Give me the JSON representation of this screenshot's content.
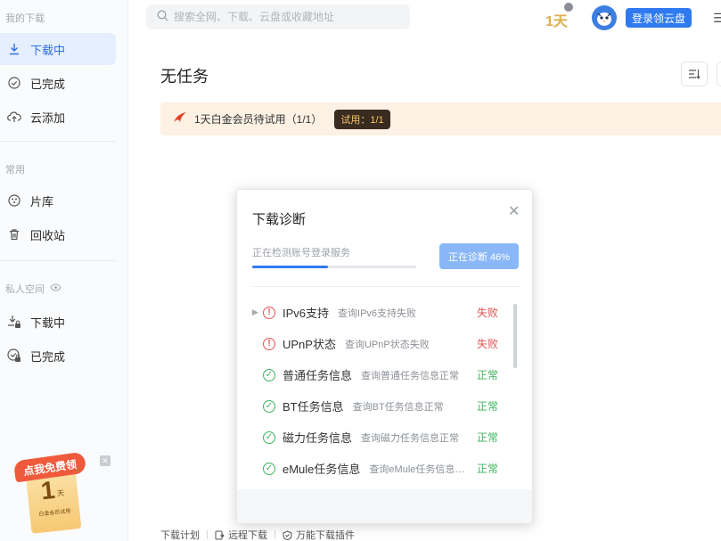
{
  "sidebar": {
    "section_downloads": "我的下载",
    "items_main": [
      {
        "label": "下载中",
        "icon": "download-icon",
        "active": true
      },
      {
        "label": "已完成",
        "icon": "check-circle-icon",
        "active": false
      },
      {
        "label": "云添加",
        "icon": "cloud-upload-icon",
        "active": false
      }
    ],
    "section_common": "常用",
    "items_common": [
      {
        "label": "片库",
        "icon": "film-icon"
      },
      {
        "label": "回收站",
        "icon": "trash-icon"
      }
    ],
    "section_private": "私人空间",
    "items_private": [
      {
        "label": "下载中",
        "icon": "locked-download-icon"
      },
      {
        "label": "已完成",
        "icon": "locked-check-icon"
      }
    ],
    "promo": {
      "badge": "点我免费领",
      "number": "1",
      "unit": "天",
      "caption": "白金会员试用"
    }
  },
  "topbar": {
    "search_placeholder": "搜索全网、下载、云盘或收藏地址",
    "vip_label": "1天",
    "login_button": "登录领云盘"
  },
  "main": {
    "title": "无任务",
    "trial_text": "1天白金会员待试用（1/1）",
    "trial_pill": "试用：1/1"
  },
  "footer": {
    "links": [
      "下载计划",
      "远程下载",
      "万能下载插件"
    ]
  },
  "dialog": {
    "title": "下载诊断",
    "status": "正在检测账号登录服务",
    "progress": 0.46,
    "button": "正在诊断 46%",
    "rows": [
      {
        "name": "IPv6支持",
        "desc": "查询IPv6支持失败",
        "state": "失败",
        "ok": false,
        "expandable": true
      },
      {
        "name": "UPnP状态",
        "desc": "查询UPnP状态失败",
        "state": "失败",
        "ok": false,
        "expandable": false
      },
      {
        "name": "普通任务信息",
        "desc": "查询普通任务信息正常",
        "state": "正常",
        "ok": true,
        "expandable": false
      },
      {
        "name": "BT任务信息",
        "desc": "查询BT任务信息正常",
        "state": "正常",
        "ok": true,
        "expandable": false
      },
      {
        "name": "磁力任务信息",
        "desc": "查询磁力任务信息正常",
        "state": "正常",
        "ok": true,
        "expandable": false
      },
      {
        "name": "eMule任务信息",
        "desc": "查询eMule任务信息正常",
        "state": "正常",
        "ok": true,
        "expandable": false
      }
    ]
  },
  "colors": {
    "accent": "#2f7af0",
    "fail": "#e05555",
    "ok": "#3fb35e"
  }
}
